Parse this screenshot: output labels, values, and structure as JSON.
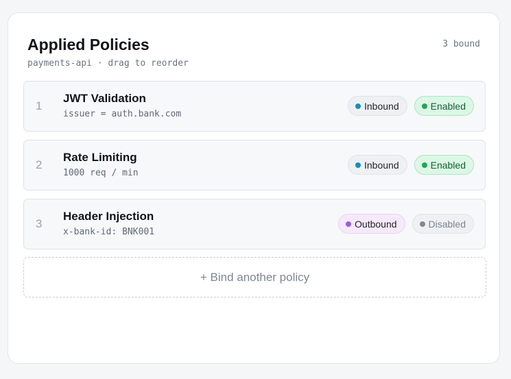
{
  "header": {
    "title": "Applied Policies",
    "subtitle": "payments-api · drag to reorder",
    "count": "3 bound"
  },
  "policies": [
    {
      "order": "1",
      "name": "JWT Validation",
      "detail": "issuer = auth.bank.com",
      "direction": "Inbound",
      "status": "Enabled"
    },
    {
      "order": "2",
      "name": "Rate Limiting",
      "detail": "1000 req / min",
      "direction": "Inbound",
      "status": "Enabled"
    },
    {
      "order": "3",
      "name": "Header Injection",
      "detail": "x-bank-id: BNK001",
      "direction": "Outbound",
      "status": "Disabled"
    }
  ],
  "add_button": {
    "label": "+ Bind another policy"
  },
  "colors": {
    "inbound_dot": "#1192b9",
    "outbound_dot": "#a35ad8",
    "enabled_dot": "#22a656",
    "enabled_bg": "#dcf7e6",
    "disabled_dot": "#7f8791"
  }
}
